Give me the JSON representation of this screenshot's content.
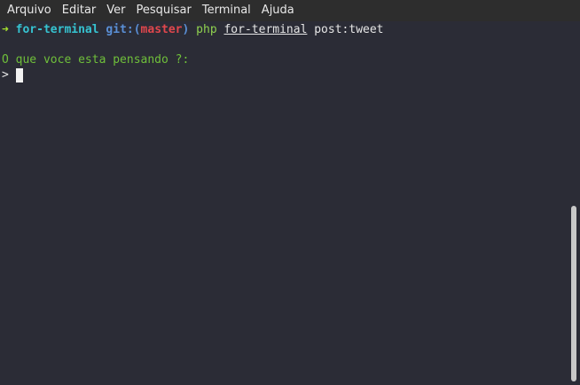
{
  "menubar": {
    "items": [
      "Arquivo",
      "Editar",
      "Ver",
      "Pesquisar",
      "Terminal",
      "Ajuda"
    ]
  },
  "terminal": {
    "prompt": {
      "arrow": "➜",
      "directory": "for-terminal",
      "git_label": "git:(",
      "git_branch": "master",
      "git_close": ")",
      "command": "php",
      "command_arg": "for-terminal",
      "command_rest": "post:tweet"
    },
    "output": {
      "question": "O que voce esta pensando ?:",
      "input_prompt": ">"
    }
  },
  "colors": {
    "background": "#2b2c36",
    "arrow": "#a6e22e",
    "directory": "#36c3d1",
    "git_label": "#5a8fd6",
    "git_branch": "#e0474d",
    "command": "#8fd14f",
    "question": "#6fbf3a"
  }
}
